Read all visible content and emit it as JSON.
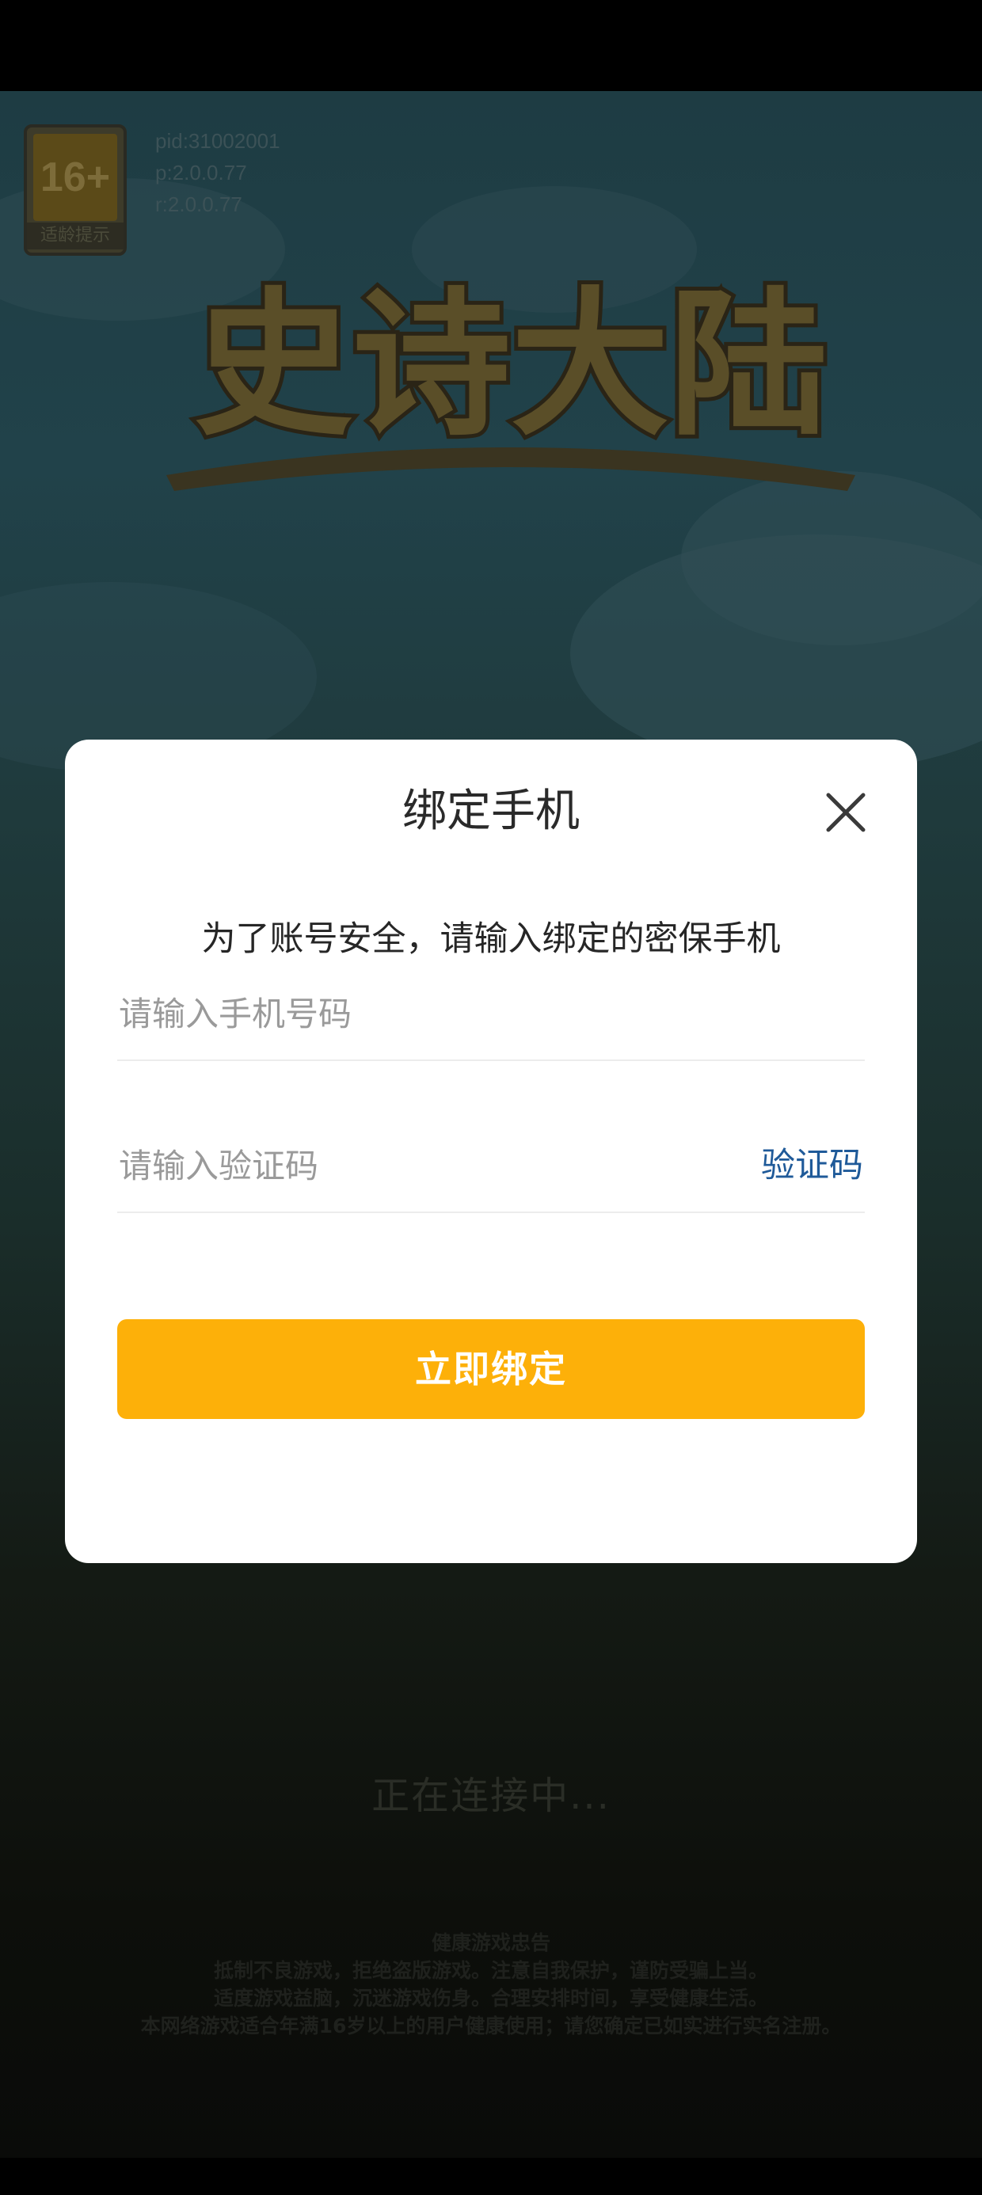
{
  "game": {
    "age_rating_label": "16+",
    "age_rating_caption": "适龄提示",
    "build_info": [
      "pid:31002001",
      "p:2.0.0.77",
      "r:2.0.0.77"
    ],
    "logo_text": "史诗大陆",
    "connecting_text": "正在连接中...",
    "health_notice": {
      "title": "健康游戏忠告",
      "lines": [
        "抵制不良游戏，拒绝盗版游戏。注意自我保护，谨防受骗上当。",
        "适度游戏益脑，沉迷游戏伤身。合理安排时间，享受健康生活。",
        "本网络游戏适合年满16岁以上的用户健康使用；请您确定已如实进行实名注册。"
      ]
    }
  },
  "dialog": {
    "title": "绑定手机",
    "subtitle": "为了账号安全，请输入绑定的密保手机",
    "phone_input": {
      "value": "",
      "placeholder": "请输入手机号码"
    },
    "code_input": {
      "value": "",
      "placeholder": "请输入验证码"
    },
    "get_code_label": "验证码",
    "submit_label": "立即绑定",
    "close_icon": "close-icon"
  },
  "colors": {
    "accent": "#fdb009",
    "link": "#1f5a99",
    "dialog_bg": "#ffffff"
  }
}
